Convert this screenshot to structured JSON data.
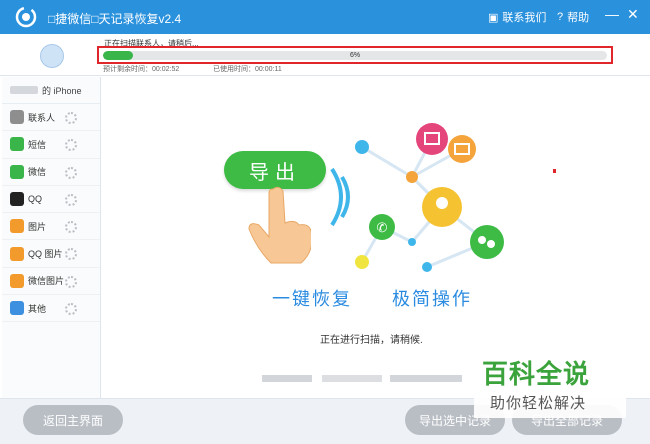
{
  "app": {
    "title": "□捷微信□天记录恢复v2.4",
    "contact_label": "联系我们",
    "help_label": "帮助",
    "minimize_glyph": "—",
    "close_glyph": "✕",
    "accent_color": "#2a91dd"
  },
  "scan": {
    "status_text": "正在扫描联系人，请稍后...",
    "progress_label": "6%",
    "progress_value": 0.06,
    "elapsed_text": "预计剩余时间：00:02:52",
    "used_text": "已使用时间：00:00:11"
  },
  "sidebar": {
    "device_suffix": "的 iPhone",
    "items": [
      {
        "label": "联系人",
        "icon": "contact-icon",
        "color": "#8e8e8e"
      },
      {
        "label": "短信",
        "icon": "sms-icon",
        "color": "#39b54a"
      },
      {
        "label": "微信",
        "icon": "wechat-icon",
        "color": "#39b54a"
      },
      {
        "label": "QQ",
        "icon": "qq-penguin-icon",
        "color": "#222222"
      },
      {
        "label": "图片",
        "icon": "photo-icon",
        "color": "#f39a2c"
      },
      {
        "label": "QQ 图片",
        "icon": "qq-photo-icon",
        "color": "#f39a2c"
      },
      {
        "label": "微信图片",
        "icon": "wechat-photo-icon",
        "color": "#f39a2c"
      },
      {
        "label": "其他",
        "icon": "other-icon",
        "color": "#3d8fe0"
      }
    ]
  },
  "main": {
    "export_label": "导出",
    "slogan_a": "一键恢复",
    "slogan_b": "极简操作",
    "scan_message": "正在进行扫描，请稍候."
  },
  "bottom": {
    "home_label": "返回主界面",
    "export_selected_label": "导出选中记录",
    "export_all_label": "导出全部记录"
  },
  "watermark": {
    "title": "百科全说",
    "subtitle": "助你轻松解决"
  }
}
